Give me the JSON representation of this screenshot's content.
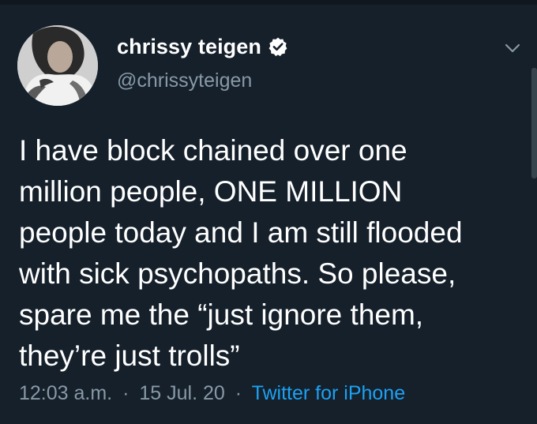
{
  "user": {
    "display_name": "chrissy teigen",
    "handle": "@chrissyteigen",
    "verified": true,
    "avatar_icon": "profile-photo"
  },
  "tweet": {
    "lines": [
      "I have block chained over one",
      "million people, ONE MILLION",
      "people today and I am still flooded",
      "with sick psychopaths. So please,",
      "spare me the “just ignore them,",
      "they’re just trolls”"
    ]
  },
  "meta": {
    "time": "12:03 a.m.",
    "separator": "·",
    "date": "15 Jul. 20",
    "source": "Twitter for iPhone"
  },
  "colors": {
    "background": "#15202b",
    "text": "#ffffff",
    "muted": "#8899a6",
    "accent": "#1da1f2"
  },
  "icons": {
    "verified": "verified-badge-icon",
    "menu": "chevron-down-icon"
  }
}
